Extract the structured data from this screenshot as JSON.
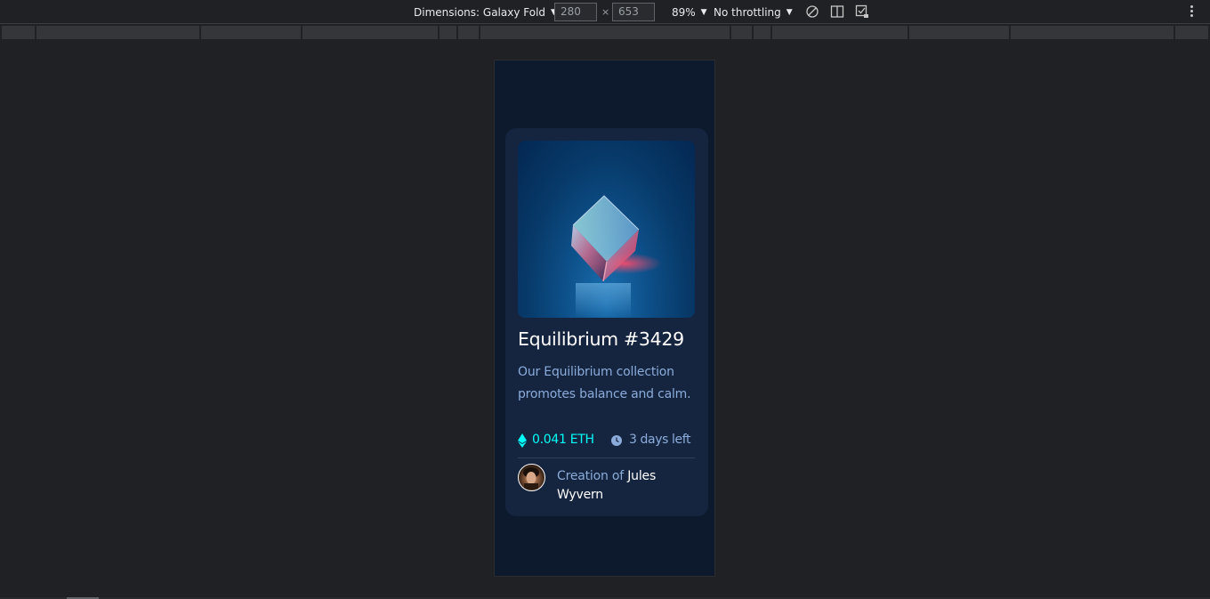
{
  "devtools": {
    "dimensions_label": "Dimensions: Galaxy Fold",
    "width_value": "280",
    "times_symbol": "×",
    "height_value": "653",
    "zoom_label": "89%",
    "throttling_label": "No throttling",
    "icons": [
      "rotate-icon",
      "dual-screen-icon",
      "device-posture-icon",
      "more-options-icon"
    ]
  },
  "card": {
    "title": "Equilibrium #3429",
    "description": "Our Equilibrium collection promotes balance and calm.",
    "price": "0.041 ETH",
    "time_left": "3 days left",
    "creator_prefix": "Creation of",
    "creator_name": "Jules Wyvern",
    "icons": [
      "ethereum-icon",
      "clock-icon"
    ]
  },
  "colors": {
    "page_bg": "#0d192c",
    "card_bg": "#15253f",
    "accent_cyan": "#00fff8",
    "soft_blue": "#8bacda",
    "white": "#ffffff"
  }
}
